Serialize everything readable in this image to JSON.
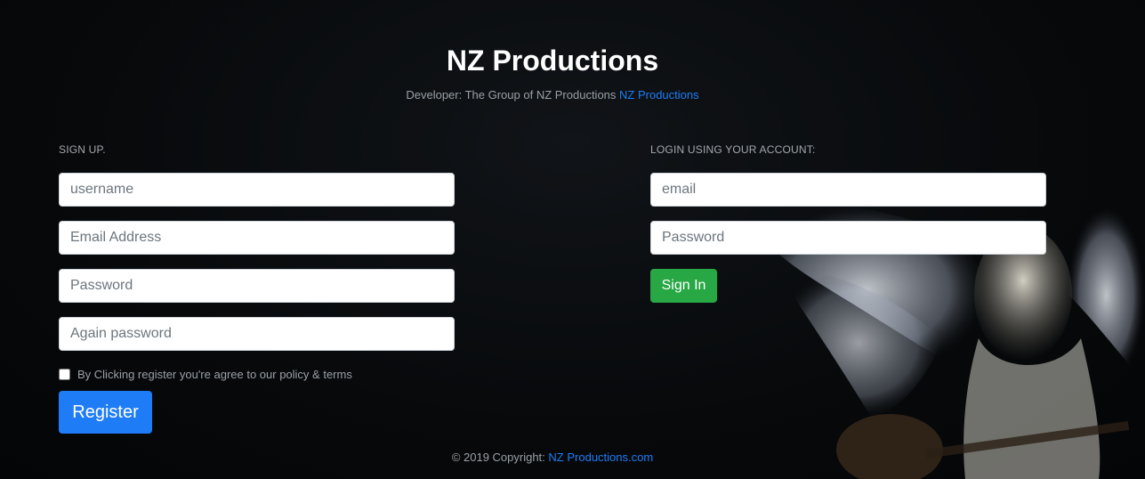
{
  "header": {
    "title": "NZ Productions",
    "developer_text": "Developer: The Group of NZ Productions",
    "developer_link": "NZ Productions"
  },
  "signup": {
    "label": "SIGN UP.",
    "username_placeholder": "username",
    "email_placeholder": "Email Address",
    "password_placeholder": "Password",
    "again_password_placeholder": "Again password",
    "terms_text": "By Clicking register you're agree to our policy & terms",
    "register_label": "Register"
  },
  "login": {
    "label": "LOGIN USING YOUR ACCOUNT:",
    "email_placeholder": "email",
    "password_placeholder": "Password",
    "signin_label": "Sign In"
  },
  "footer": {
    "copyright_text": "© 2019 Copyright:",
    "link_text": "NZ Productions.com"
  },
  "colors": {
    "primary": "#1e7cf7",
    "success": "#28a745",
    "background": "#07090b"
  }
}
